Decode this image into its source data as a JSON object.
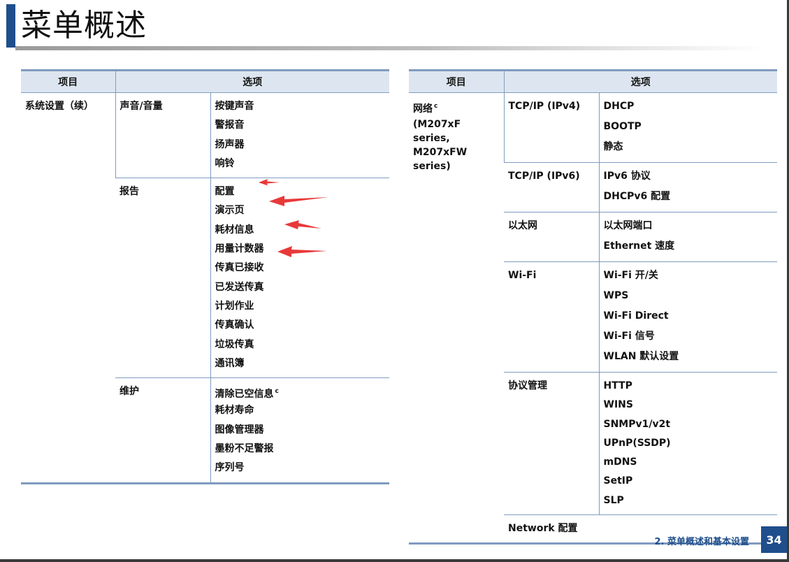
{
  "page": {
    "title": "菜单概述"
  },
  "colors": {
    "accent": "#1f4e8c",
    "table_rule": "#7f9bbf",
    "header_bg": "#dde6f0",
    "arrow": "#e8393a"
  },
  "left_table": {
    "headers": {
      "item": "项目",
      "option": "选项"
    },
    "category": "系统设置（续）",
    "groups": {
      "sound": {
        "name": "声音/音量",
        "options": [
          "按键声音",
          "警报音",
          "扬声器",
          "响铃"
        ]
      },
      "report": {
        "name": "报告",
        "options": [
          "配置",
          "演示页",
          "耗材信息",
          "用量计数器",
          "传真已接收",
          "已发送传真",
          "计划作业",
          "传真确认",
          "垃圾传真",
          "通讯簿"
        ]
      },
      "maintenance": {
        "name": "维护",
        "options": [
          "清除已空信息",
          "耗材寿命",
          "图像管理器",
          "墨粉不足警报",
          "序列号"
        ],
        "first_sup": "c"
      }
    }
  },
  "right_table": {
    "headers": {
      "item": "项目",
      "option": "选项"
    },
    "category": {
      "name": "网络",
      "sup": "c",
      "note": "(M207xF series, M207xFW series)"
    },
    "groups": {
      "ipv4": {
        "name": "TCP/IP (IPv4)",
        "options": [
          "DHCP",
          "BOOTP",
          "静态"
        ]
      },
      "ipv6": {
        "name": "TCP/IP (IPv6)",
        "options": [
          "IPv6 协议",
          "DHCPv6 配置"
        ]
      },
      "ethernet": {
        "name": "以太网",
        "options": [
          "以太网端口",
          "Ethernet 速度"
        ]
      },
      "wifi": {
        "name": "Wi-Fi",
        "options": [
          "Wi-Fi 开/关",
          "WPS",
          "Wi-Fi Direct",
          "Wi-Fi 信号",
          "WLAN 默认设置"
        ]
      },
      "protocol": {
        "name": "协议管理",
        "options": [
          "HTTP",
          "WINS",
          "SNMPv1/v2t",
          "UPnP(SSDP)",
          "mDNS",
          "SetIP",
          "SLP"
        ]
      },
      "network_config": {
        "name": "Network 配置"
      }
    }
  },
  "footer": {
    "section": "2.  菜单概述和基本设置",
    "page_number": "34"
  }
}
